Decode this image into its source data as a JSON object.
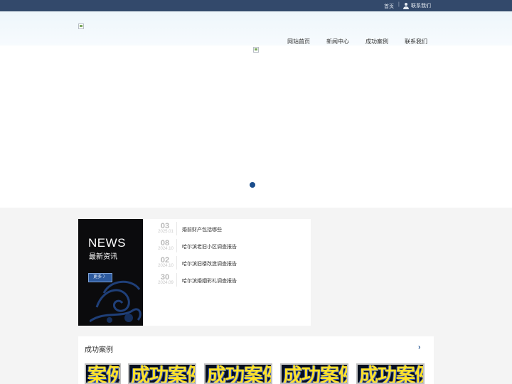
{
  "topbar": {
    "home": "首页",
    "sep": "|",
    "contact": "联系我们"
  },
  "nav": [
    "网站首页",
    "新闻中心",
    "成功案例",
    "联系我们"
  ],
  "news": {
    "title": "NEWS",
    "subtitle": "最新资讯",
    "more": "更多 〉",
    "items": [
      {
        "day": "03",
        "ym": "2025.01",
        "title": "婚前财产包括哪些"
      },
      {
        "day": "08",
        "ym": "2024.10",
        "title": "哈尔滨老旧小区调查报告"
      },
      {
        "day": "02",
        "ym": "2024.10",
        "title": "哈尔滨旧楼改造调查报告"
      },
      {
        "day": "30",
        "ym": "2024.09",
        "title": "哈尔滨婚姻彩礼调查报告"
      }
    ]
  },
  "cases": {
    "title": "成功案例",
    "arrow": "›",
    "thumbs": [
      "案例",
      "成功案例",
      "成功案例",
      "成功案例",
      "成功案例"
    ]
  },
  "colors": {
    "topbar": "#33496b",
    "accent": "#1b4d8c",
    "news_dark": "#0b0b0d"
  }
}
